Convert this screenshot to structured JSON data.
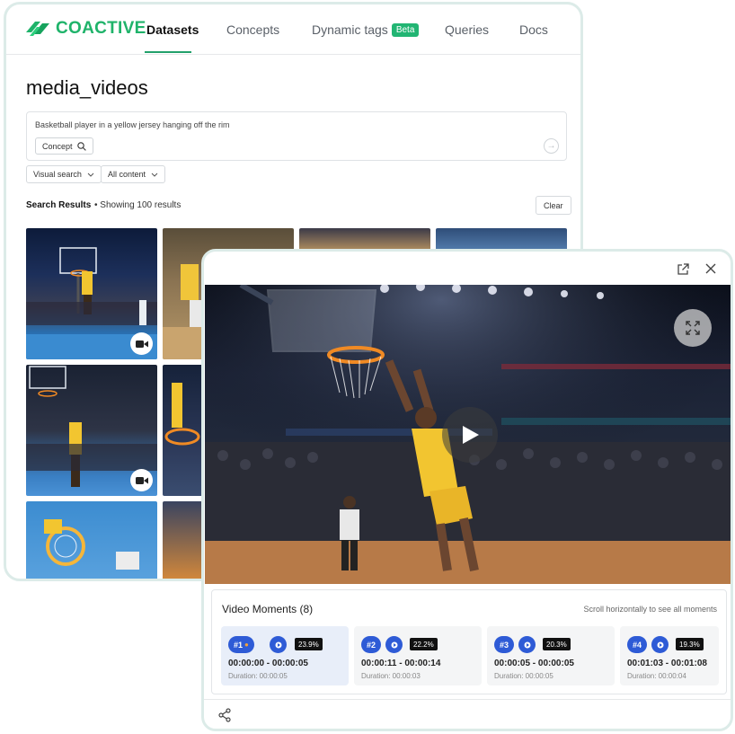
{
  "app": {
    "brand": "COACTIVE",
    "nav": [
      {
        "label": "Datasets",
        "active": true
      },
      {
        "label": "Concepts"
      },
      {
        "label": "Dynamic tags",
        "badge": "Beta"
      },
      {
        "label": "Queries"
      },
      {
        "label": "Docs"
      }
    ],
    "accent": "#22a06b"
  },
  "page": {
    "title": "media_videos",
    "search": {
      "query": "Basketball player in a yellow jersey hanging off the rim",
      "mode": "Concept"
    },
    "filters": {
      "search_type": "Visual search",
      "content": "All content"
    },
    "results": {
      "label": "Search Results",
      "count_text": "Showing 100 results",
      "clear": "Clear"
    }
  },
  "modal": {
    "moments_title": "Video Moments (8)",
    "moments_hint": "Scroll horizontally to see all moments",
    "moments": [
      {
        "rank": "#1",
        "score": "23.9%",
        "range": "00:00:00 - 00:00:05",
        "duration": "Duration: 00:00:05"
      },
      {
        "rank": "#2",
        "score": "22.2%",
        "range": "00:00:11 - 00:00:14",
        "duration": "Duration: 00:00:03"
      },
      {
        "rank": "#3",
        "score": "20.3%",
        "range": "00:00:05 - 00:00:05",
        "duration": "Duration: 00:00:05"
      },
      {
        "rank": "#4",
        "score": "19.3%",
        "range": "00:01:03 - 00:01:08",
        "duration": "Duration: 00:00:04"
      }
    ],
    "selected_color": "#e8eef9",
    "pill_color": "#2e5bd6"
  },
  "icons": [
    "search-icon",
    "arrow-right-icon",
    "chevron-down-icon",
    "video-camera-icon",
    "external-link-icon",
    "close-icon",
    "expand-icon",
    "play-icon",
    "share-icon"
  ]
}
